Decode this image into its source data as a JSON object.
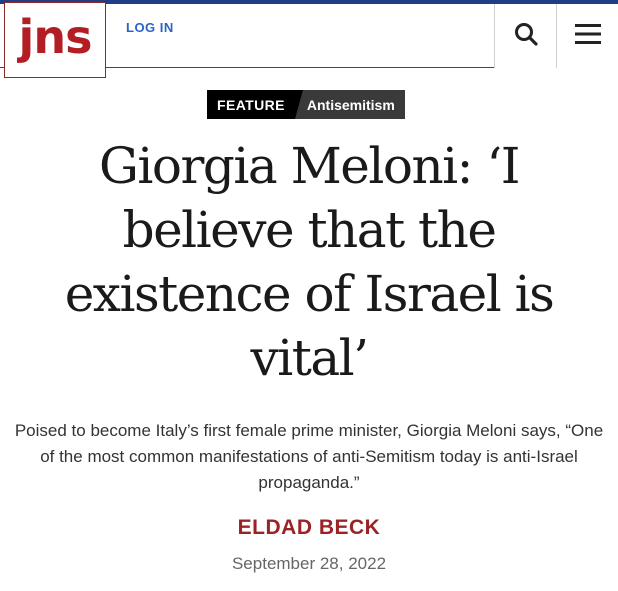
{
  "header": {
    "logo_text": "jns",
    "login_label": "LOG IN",
    "search_icon": "search-icon",
    "menu_icon": "hamburger-menu-icon",
    "accent_color": "#b21e23",
    "topline_color": "#1e3f86",
    "link_color": "#2b63c6"
  },
  "article": {
    "tag_type": "FEATURE",
    "tag_topic": "Antisemitism",
    "headline": "Giorgia Meloni: ‘I believe that the existence of Israel is vital’",
    "deck": "Poised to become Italy’s first female prime minister, Giorgia Meloni says, “One of the most common manifestations of anti-Semitism today is anti-Israel propaganda.”",
    "author": "ELDAD BECK",
    "date": "September 28, 2022",
    "author_color": "#9b2326"
  }
}
